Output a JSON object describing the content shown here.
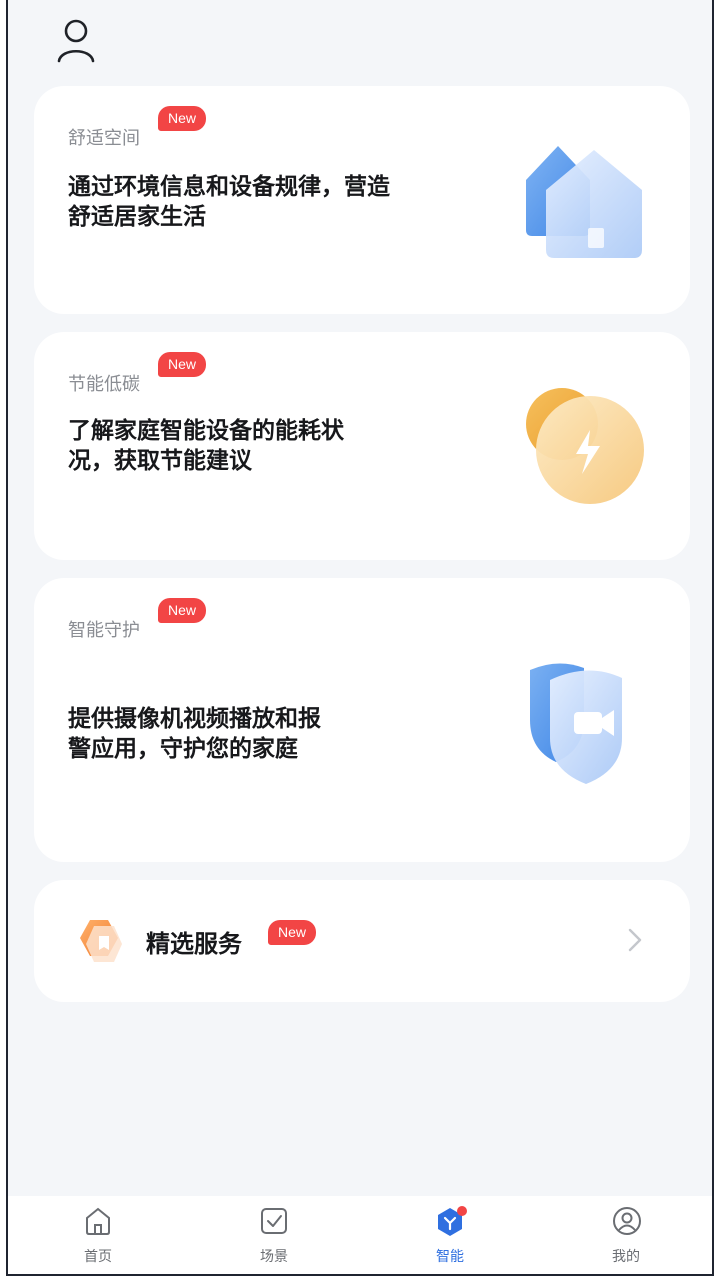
{
  "header": {
    "user_icon": "user-icon"
  },
  "cards": [
    {
      "label": "舒适空间",
      "badge": "New",
      "desc_line1": "通过环境信息和设备规律，营造",
      "desc_line2": "舒适居家生活",
      "icon": "house-icon"
    },
    {
      "label": "节能低碳",
      "badge": "New",
      "desc_line1": "了解家庭智能设备的能耗状",
      "desc_line2": "况，获取节能建议",
      "icon": "lightning-icon"
    },
    {
      "label": "智能守护",
      "badge": "New",
      "desc_line1": "提供摄像机视频播放和报",
      "desc_line2": "警应用，守护您的家庭",
      "icon": "shield-camera-icon"
    }
  ],
  "service": {
    "label": "精选服务",
    "badge": "New",
    "icon": "service-icon"
  },
  "tabs": [
    {
      "label": "首页",
      "icon": "home-icon",
      "active": false
    },
    {
      "label": "场景",
      "icon": "checkbox-icon",
      "active": false
    },
    {
      "label": "智能",
      "icon": "smart-icon",
      "active": true
    },
    {
      "label": "我的",
      "icon": "profile-icon",
      "active": false
    }
  ],
  "colors": {
    "accent": "#2f6fe0",
    "badge": "#f24545",
    "background": "#f4f6f9"
  }
}
